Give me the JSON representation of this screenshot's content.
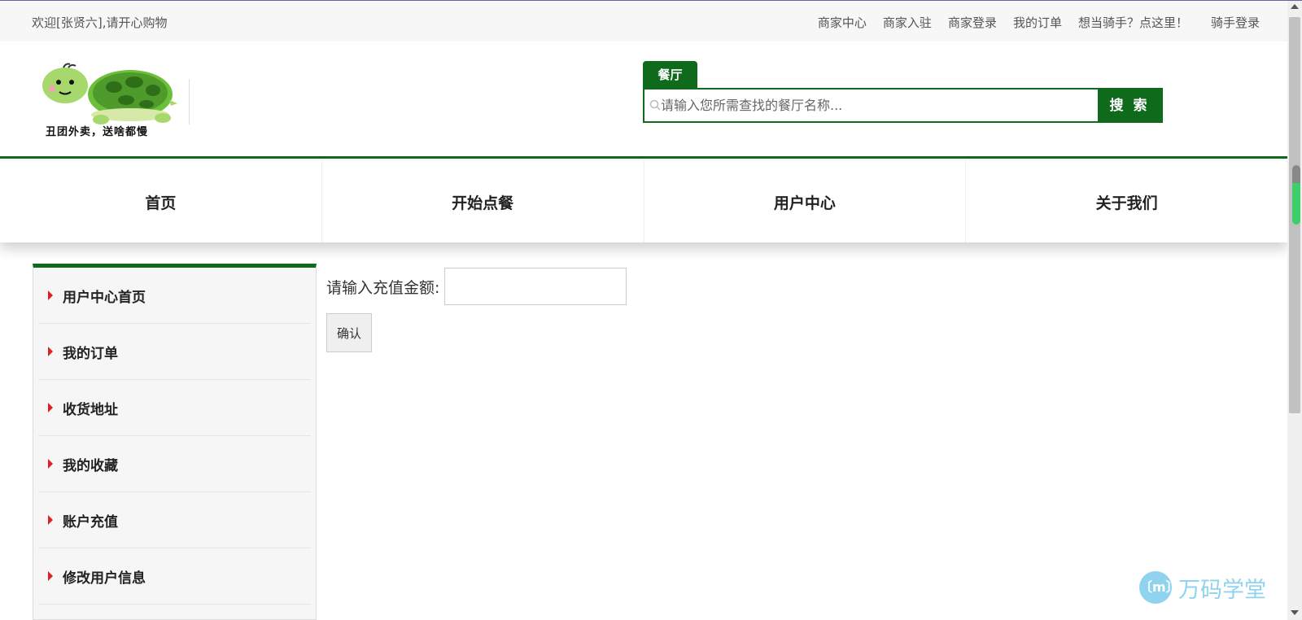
{
  "topbar": {
    "welcome": "欢迎[张贤六],请开心购物",
    "links": [
      "商家中心",
      "商家入驻",
      "商家登录",
      "我的订单",
      "想当骑手？点这里！",
      "骑手登录"
    ]
  },
  "header": {
    "logo_text": "丑团外卖，送啥都慢",
    "search_tab": "餐厅",
    "search_placeholder": "请输入您所需查找的餐厅名称...",
    "search_button": "搜 索"
  },
  "nav": {
    "items": [
      "首页",
      "开始点餐",
      "用户中心",
      "关于我们"
    ]
  },
  "sidebar": {
    "items": [
      "用户中心首页",
      "我的订单",
      "收货地址",
      "我的收藏",
      "账户充值",
      "修改用户信息"
    ]
  },
  "recharge": {
    "label": "请输入充值金额:",
    "amount_value": "",
    "confirm": "确认"
  },
  "watermark": {
    "text": "万码学堂",
    "icon_text": "〔m〕"
  },
  "colors": {
    "brand_green": "#0f6a1b",
    "arrow_red": "#e02020"
  }
}
